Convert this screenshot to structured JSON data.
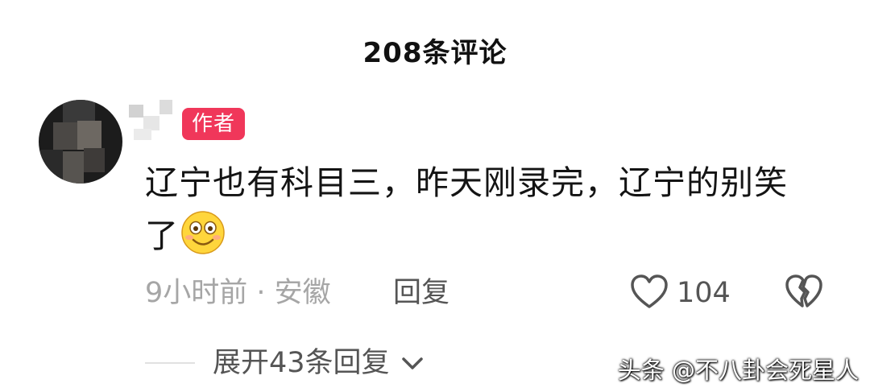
{
  "header": {
    "title": "208条评论"
  },
  "comment": {
    "badge": "作者",
    "text": "辽宁也有科目三，昨天刚录完，辽宁的别笑了",
    "emoji": "smiley-icon",
    "meta": "9小时前 · 安徽",
    "reply_label": "回复",
    "like_count": "104",
    "icons": {
      "like": "heart-outline-icon",
      "dislike": "broken-heart-icon"
    }
  },
  "replies": {
    "expand_label": "展开43条回复",
    "icon": "chevron-down-icon"
  },
  "watermark": "头条 @不八卦会死星人",
  "colors": {
    "badge_bg": "#f0375a",
    "meta_text": "#a6a6a6",
    "action_text": "#555555"
  }
}
